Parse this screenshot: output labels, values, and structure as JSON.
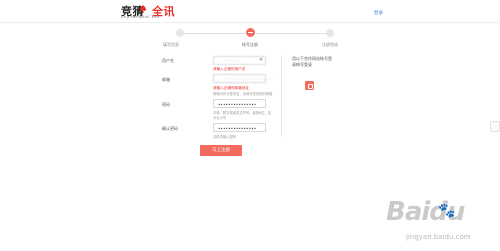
{
  "header": {
    "logo_cn_part1": "竞猜",
    "logo_cn_part2": "全讯",
    "logo_pinyin": "jing cai   quan xun",
    "login_link": "登录"
  },
  "steps": [
    {
      "label": "填写信息",
      "active": false
    },
    {
      "label": "帐号注册",
      "active": true
    },
    {
      "label": "注册完成",
      "active": false
    }
  ],
  "form": {
    "username": {
      "label": "用户名",
      "value": "~~~~~~~~",
      "error": "请输入正确的用户名"
    },
    "email": {
      "label": "邮箱",
      "value": "~~~~~~~~~~~~~~~~~~",
      "error": "请输入正确的邮箱地址",
      "hint": "邮箱可作为登录名，请填写您常用的邮箱"
    },
    "password": {
      "label": "密码",
      "value": "•••••••••••••••",
      "hint": "字母、数字或者英文符号，最短6位，区分大小写"
    },
    "confirm_password": {
      "label": "确认密码",
      "value": "•••••••••••••••",
      "hint": "请再次输入密码"
    },
    "submit_label": "马上注册"
  },
  "sidebar": {
    "text": "用以下合作网站帐号登录帐号登录"
  },
  "watermark": {
    "main": "Baidu",
    "sub": "jingyan.baidu.com"
  },
  "colors": {
    "accent": "#f26b5e",
    "error": "#e8302c",
    "link": "#4a7fd6"
  }
}
